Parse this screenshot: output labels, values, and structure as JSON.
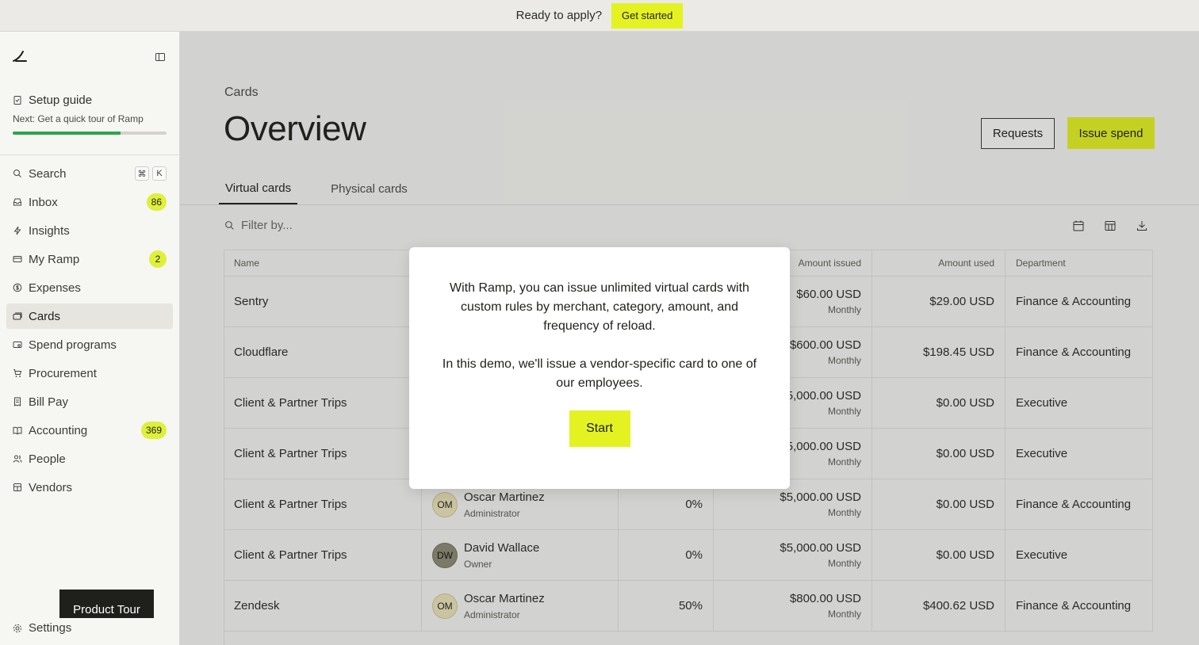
{
  "banner": {
    "text": "Ready to apply?",
    "cta": "Get started"
  },
  "sidebar": {
    "setup": {
      "title": "Setup guide",
      "next": "Next: Get a quick tour of Ramp",
      "progress": 0.7
    },
    "items": [
      {
        "label": "Search",
        "icon": "search-icon",
        "kbd": [
          "⌘",
          "K"
        ]
      },
      {
        "label": "Inbox",
        "icon": "inbox-icon",
        "badge": "86"
      },
      {
        "label": "Insights",
        "icon": "bolt-icon"
      },
      {
        "label": "My Ramp",
        "icon": "card-icon",
        "badge": "2"
      },
      {
        "label": "Expenses",
        "icon": "dollar-icon"
      },
      {
        "label": "Cards",
        "icon": "cards-icon",
        "active": true
      },
      {
        "label": "Spend programs",
        "icon": "spend-programs-icon"
      },
      {
        "label": "Procurement",
        "icon": "cart-icon"
      },
      {
        "label": "Bill Pay",
        "icon": "bill-icon"
      },
      {
        "label": "Accounting",
        "icon": "book-icon",
        "badge": "369"
      },
      {
        "label": "People",
        "icon": "people-icon"
      },
      {
        "label": "Vendors",
        "icon": "vendors-icon"
      }
    ],
    "settings": "Settings",
    "product_tour": "Product Tour"
  },
  "main": {
    "breadcrumb": "Cards",
    "title": "Overview",
    "requests_label": "Requests",
    "issue_label": "Issue spend",
    "tabs": [
      "Virtual cards",
      "Physical cards"
    ],
    "filter_placeholder": "Filter by..."
  },
  "table": {
    "headers": {
      "name": "Name",
      "issued": "Amount issued",
      "used": "Amount used",
      "department": "Department"
    },
    "rows": [
      {
        "name": "Sentry",
        "issued": "$60.00 USD",
        "period": "Monthly",
        "used": "$29.00 USD",
        "department": "Finance & Accounting"
      },
      {
        "name": "Cloudflare",
        "issued": "$600.00 USD",
        "period": "Monthly",
        "used": "$198.45 USD",
        "department": "Finance & Accounting"
      },
      {
        "name": "Client & Partner Trips",
        "issued": "$5,000.00 USD",
        "period": "Monthly",
        "used": "$0.00 USD",
        "department": "Executive"
      },
      {
        "name": "Client & Partner Trips",
        "issued": "$5,000.00 USD",
        "period": "Monthly",
        "used": "$0.00 USD",
        "department": "Executive"
      },
      {
        "name": "Client & Partner Trips",
        "initials": "OM",
        "owner": "Oscar Martinez",
        "role": "Administrator",
        "pct": "0%",
        "issued": "$5,000.00 USD",
        "period": "Monthly",
        "used": "$0.00 USD",
        "department": "Finance & Accounting"
      },
      {
        "name": "Client & Partner Trips",
        "initials": "DW",
        "owner": "David Wallace",
        "role": "Owner",
        "pct": "0%",
        "issued": "$5,000.00 USD",
        "period": "Monthly",
        "used": "$0.00 USD",
        "department": "Executive"
      },
      {
        "name": "Zendesk",
        "initials": "OM",
        "owner": "Oscar Martinez",
        "role": "Administrator",
        "pct": "50%",
        "issued": "$800.00 USD",
        "period": "Monthly",
        "used": "$400.62 USD",
        "department": "Finance & Accounting"
      }
    ]
  },
  "modal": {
    "line1": "With Ramp, you can issue unlimited virtual cards with custom rules by merchant, category, amount, and frequency of reload.",
    "line2": "In this demo, we'll issue a vendor-specific card to one of our employees.",
    "start_label": "Start"
  },
  "colors": {
    "accent": "#e4f222",
    "progress": "#2aa64b",
    "dark": "#1f1f1c"
  }
}
